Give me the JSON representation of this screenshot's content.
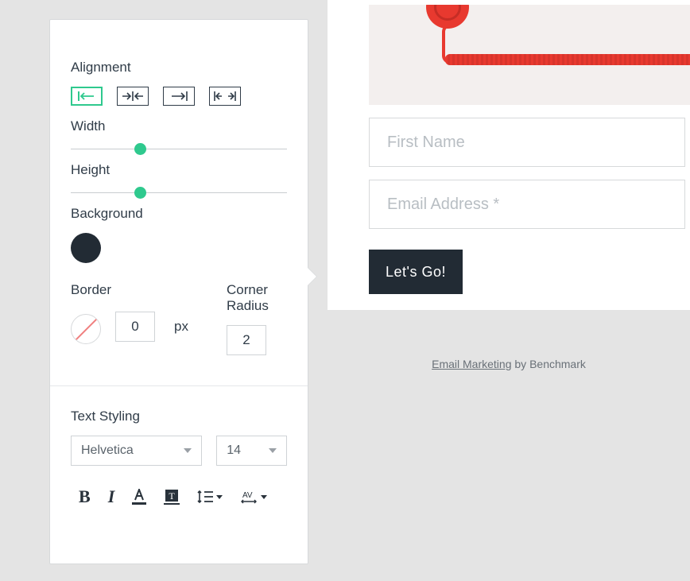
{
  "panel": {
    "alignment_label": "Alignment",
    "width_label": "Width",
    "height_label": "Height",
    "background_label": "Background",
    "border_label": "Border",
    "corner_label": "Corner Radius",
    "border_value": "0",
    "corner_value": "2",
    "px_unit": "px",
    "text_styling_label": "Text Styling",
    "font_family": "Helvetica",
    "font_size": "14",
    "background_color": "#222b34",
    "border_color": "none",
    "width_slider_pct": 30,
    "height_slider_pct": 30,
    "alignment_selected": 0
  },
  "form": {
    "first_name_placeholder": "First Name",
    "email_placeholder": "Email Address *",
    "cta_label": "Let's Go!"
  },
  "footer": {
    "link_text": "Email Marketing",
    "suffix": " by Benchmark"
  }
}
